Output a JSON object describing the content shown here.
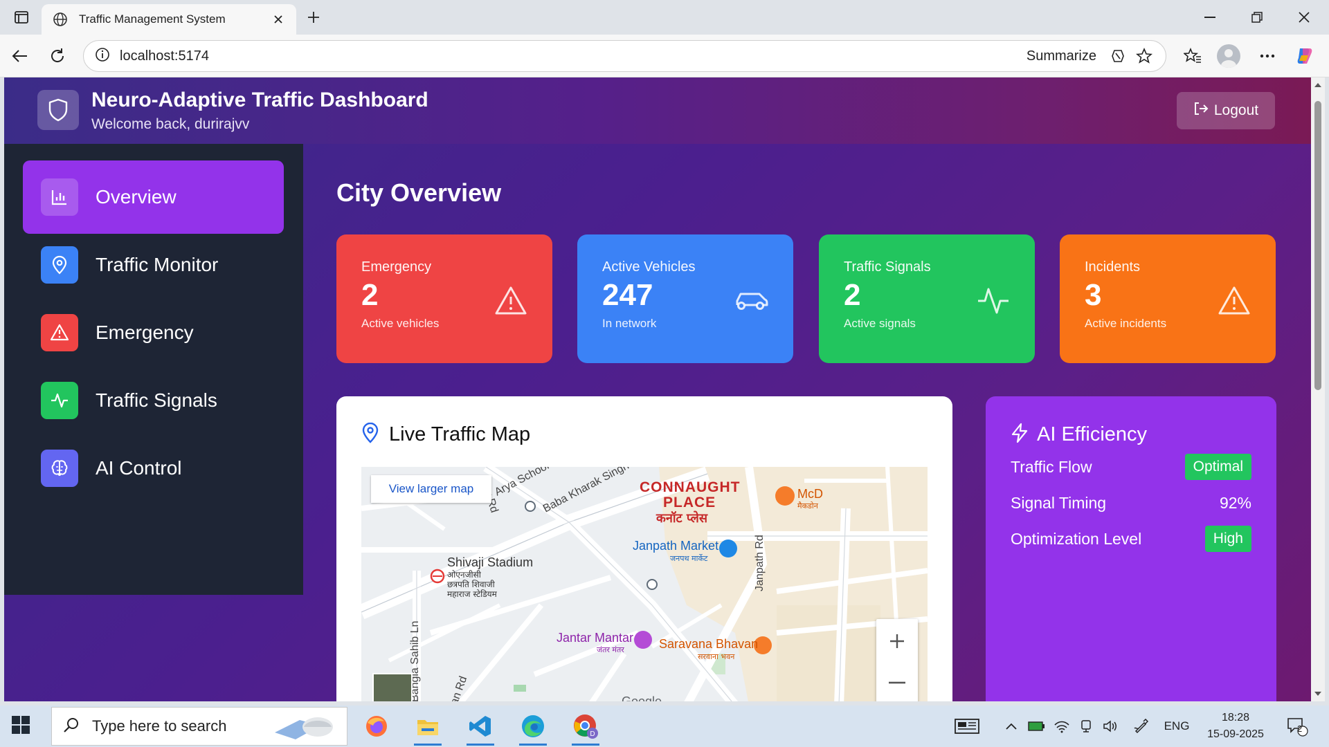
{
  "browser": {
    "tab_title": "Traffic Management System",
    "url": "localhost:5174",
    "summarize_label": "Summarize"
  },
  "header": {
    "title": "Neuro-Adaptive Traffic Dashboard",
    "welcome": "Welcome back, durirajvv",
    "logout_label": "Logout"
  },
  "sidebar": {
    "items": [
      {
        "label": "Overview",
        "icon": "bar-chart-icon",
        "color": "#9333ea"
      },
      {
        "label": "Traffic Monitor",
        "icon": "map-pin-icon",
        "color": "#3b82f6"
      },
      {
        "label": "Emergency",
        "icon": "alert-triangle-icon",
        "color": "#ef4444"
      },
      {
        "label": "Traffic Signals",
        "icon": "activity-icon",
        "color": "#22c55e"
      },
      {
        "label": "AI Control",
        "icon": "brain-icon",
        "color": "#6366f1"
      }
    ]
  },
  "main": {
    "title": "City Overview",
    "stats": [
      {
        "label": "Emergency",
        "value": "2",
        "sub": "Active vehicles",
        "color": "#ef4444",
        "icon": "alert-triangle-icon"
      },
      {
        "label": "Active Vehicles",
        "value": "247",
        "sub": "In network",
        "color": "#3b82f6",
        "icon": "car-icon"
      },
      {
        "label": "Traffic Signals",
        "value": "2",
        "sub": "Active signals",
        "color": "#22c55e",
        "icon": "activity-icon"
      },
      {
        "label": "Incidents",
        "value": "3",
        "sub": "Active incidents",
        "color": "#f97316",
        "icon": "alert-triangle-icon"
      }
    ],
    "map": {
      "title": "Live Traffic Map",
      "view_larger": "View larger map",
      "labels": {
        "connaught1": "CONNAUGHT",
        "connaught2": "PLACE",
        "connaught_hi": "कनॉट प्लेस",
        "janpath_market": "Janpath Market",
        "janpath_market_hi": "जनपथ मार्केट",
        "shivaji": "Shivaji Stadium",
        "shivaji_hi1": "ओएनजीसी",
        "shivaji_hi2": "छत्रपति शिवाजी",
        "shivaji_hi3": "महाराज स्टेडियम",
        "janpath_rd": "Janpath Rd",
        "jantar": "Jantar Mantar",
        "jantar_hi": "जंतर मंतर",
        "saravana": "Saravana Bhavan",
        "saravana_hi": "सरवाना भवन",
        "arya": "Arya School Ln",
        "baba": "Baba Kharak Singh",
        "bangla": "Bangla Sahib Ln",
        "mcd": "McD",
        "mcd_hi": "मैकडोन",
        "google": "Google",
        "ar_rd": "ar Rd",
        "an_rd": "an Rd"
      }
    },
    "ai": {
      "title": "AI Efficiency",
      "rows": [
        {
          "label": "Traffic Flow",
          "value": "Optimal",
          "badge": true
        },
        {
          "label": "Signal Timing",
          "value": "92%",
          "badge": false
        },
        {
          "label": "Optimization Level",
          "value": "High",
          "badge": true
        }
      ]
    }
  },
  "taskbar": {
    "search_placeholder": "Type here to search",
    "lang": "ENG",
    "time": "18:28",
    "date": "15-09-2025",
    "notif_count": "2"
  }
}
